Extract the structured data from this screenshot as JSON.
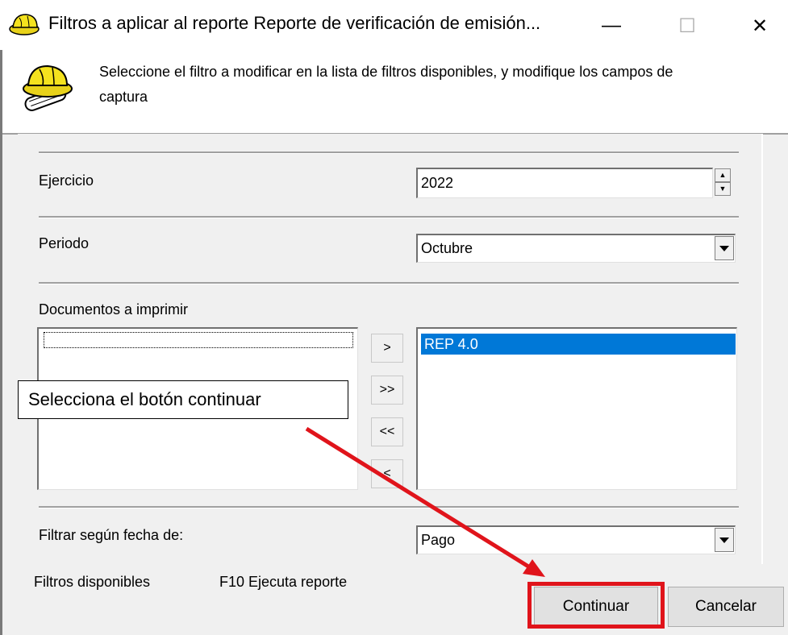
{
  "window": {
    "title": "Filtros a aplicar al reporte Reporte de verificación de emisión...",
    "minimize_glyph": "—",
    "maximize_glyph": "☐",
    "close_glyph": "✕"
  },
  "header": {
    "instruction": "Seleccione el filtro a modificar  en la lista de filtros disponibles, y modifique los campos de  captura",
    "icon": "hardhat-blueprint-icon"
  },
  "filters": {
    "ejercicio_label": "Ejercicio",
    "ejercicio_value": "2022",
    "periodo_label": "Periodo",
    "periodo_value": "Octubre",
    "documentos_label": "Documentos a imprimir",
    "available_items": [
      ""
    ],
    "selected_items": [
      "REP 4.0"
    ],
    "move_buttons": [
      ">",
      ">>",
      "<<",
      "<"
    ],
    "fecha_label": "Filtrar según fecha de:",
    "fecha_value": "Pago"
  },
  "footer": {
    "filtros_disponibles": "Filtros disponibles",
    "f10_hint": "F10 Ejecuta reporte",
    "continuar_label": "Continuar",
    "cancelar_label": "Cancelar"
  },
  "annotation": {
    "callout_text": "Selecciona el botón continuar",
    "color": "#e0141b"
  },
  "colors": {
    "selection": "#0078d7",
    "window_bg": "#f0f0f0"
  }
}
